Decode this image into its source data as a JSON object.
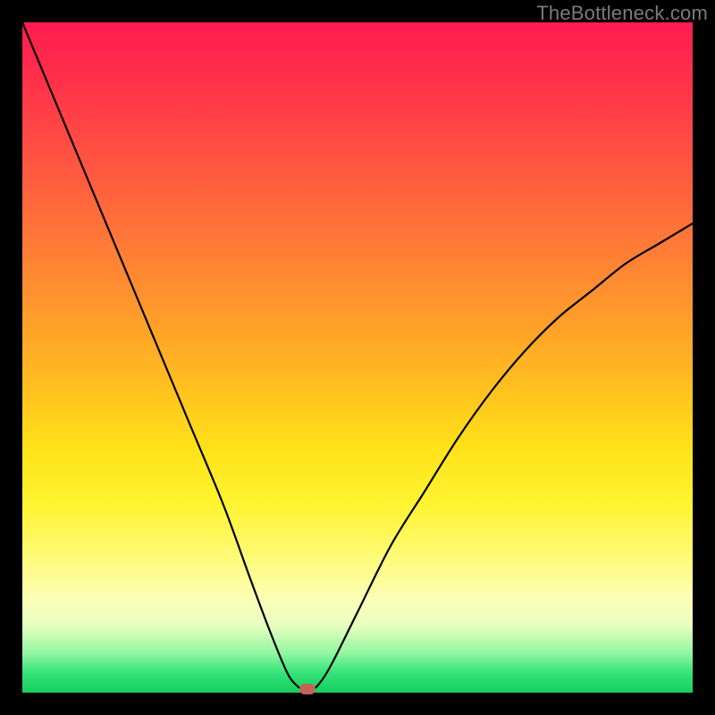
{
  "watermark": "TheBottleneck.com",
  "chart_data": {
    "type": "line",
    "title": "",
    "xlabel": "",
    "ylabel": "",
    "xlim": [
      0,
      100
    ],
    "ylim": [
      0,
      100
    ],
    "series": [
      {
        "name": "bottleneck-curve",
        "x": [
          0,
          5,
          10,
          15,
          20,
          25,
          30,
          34,
          37,
          39.5,
          41,
          42,
          43,
          44,
          46,
          50,
          55,
          60,
          65,
          70,
          75,
          80,
          85,
          90,
          95,
          100
        ],
        "y": [
          100,
          88,
          76,
          64,
          52,
          40,
          28,
          17,
          9,
          3,
          1,
          0.5,
          0.5,
          1,
          4,
          12,
          22,
          30,
          38,
          45,
          51,
          56,
          60,
          64,
          67,
          70
        ]
      }
    ],
    "marker": {
      "x": 42.5,
      "y": 0.5
    },
    "gradient_stops": [
      {
        "pos": 0,
        "color": "#ff1c50"
      },
      {
        "pos": 50,
        "color": "#ffc61e"
      },
      {
        "pos": 85,
        "color": "#fdffb8"
      },
      {
        "pos": 100,
        "color": "#14cf5e"
      }
    ]
  }
}
